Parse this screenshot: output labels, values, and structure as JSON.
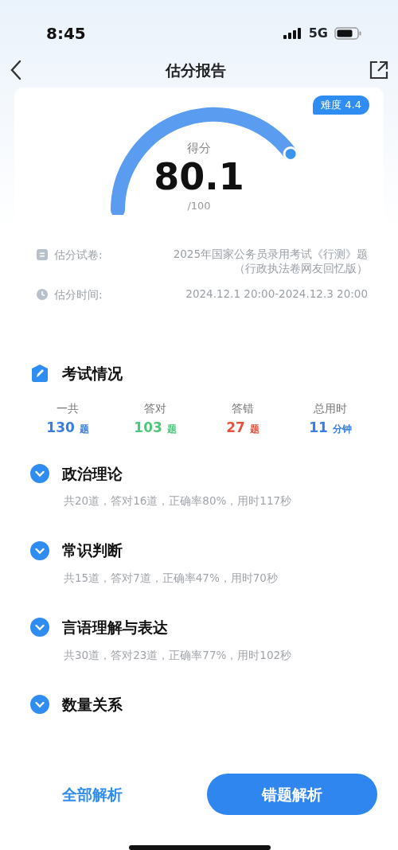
{
  "status_bar": {
    "time": "8:45",
    "network": "5G"
  },
  "header": {
    "title": "估分报告"
  },
  "score": {
    "difficulty": "难度 4.4",
    "label": "得分",
    "value": "80.1",
    "total": "/100"
  },
  "info": [
    {
      "kind": "paper",
      "label": "估分试卷:",
      "lines": [
        "2025年国家公务员录用考试《行测》题",
        "（行政执法卷网友回忆版）"
      ]
    },
    {
      "kind": "time",
      "label": "估分时间:",
      "lines": [
        "2024.12.1 20:00-2024.12.3 20:00"
      ]
    }
  ],
  "exam": {
    "title": "考试情况",
    "stats": [
      {
        "label": "一共",
        "value": "130",
        "unit": "题",
        "color": "#3a7de0"
      },
      {
        "label": "答对",
        "value": "103",
        "unit": "题",
        "color": "#4cc77a"
      },
      {
        "label": "答错",
        "value": "27",
        "unit": "题",
        "color": "#e5533f"
      },
      {
        "label": "总用时",
        "value": "11",
        "unit": "分钟",
        "color": "#3a7de0"
      }
    ]
  },
  "subjects": [
    {
      "name": "政治理论",
      "summary": "共20道，答对16道，正确率80%，用时117秒"
    },
    {
      "name": "常识判断",
      "summary": "共15道，答对7道，正确率47%，用时70秒"
    },
    {
      "name": "言语理解与表达",
      "summary": "共30道，答对23道，正确率77%，用时102秒"
    },
    {
      "name": "数量关系"
    }
  ],
  "buttons": {
    "secondary": "全部解析",
    "primary": "错题解析"
  }
}
